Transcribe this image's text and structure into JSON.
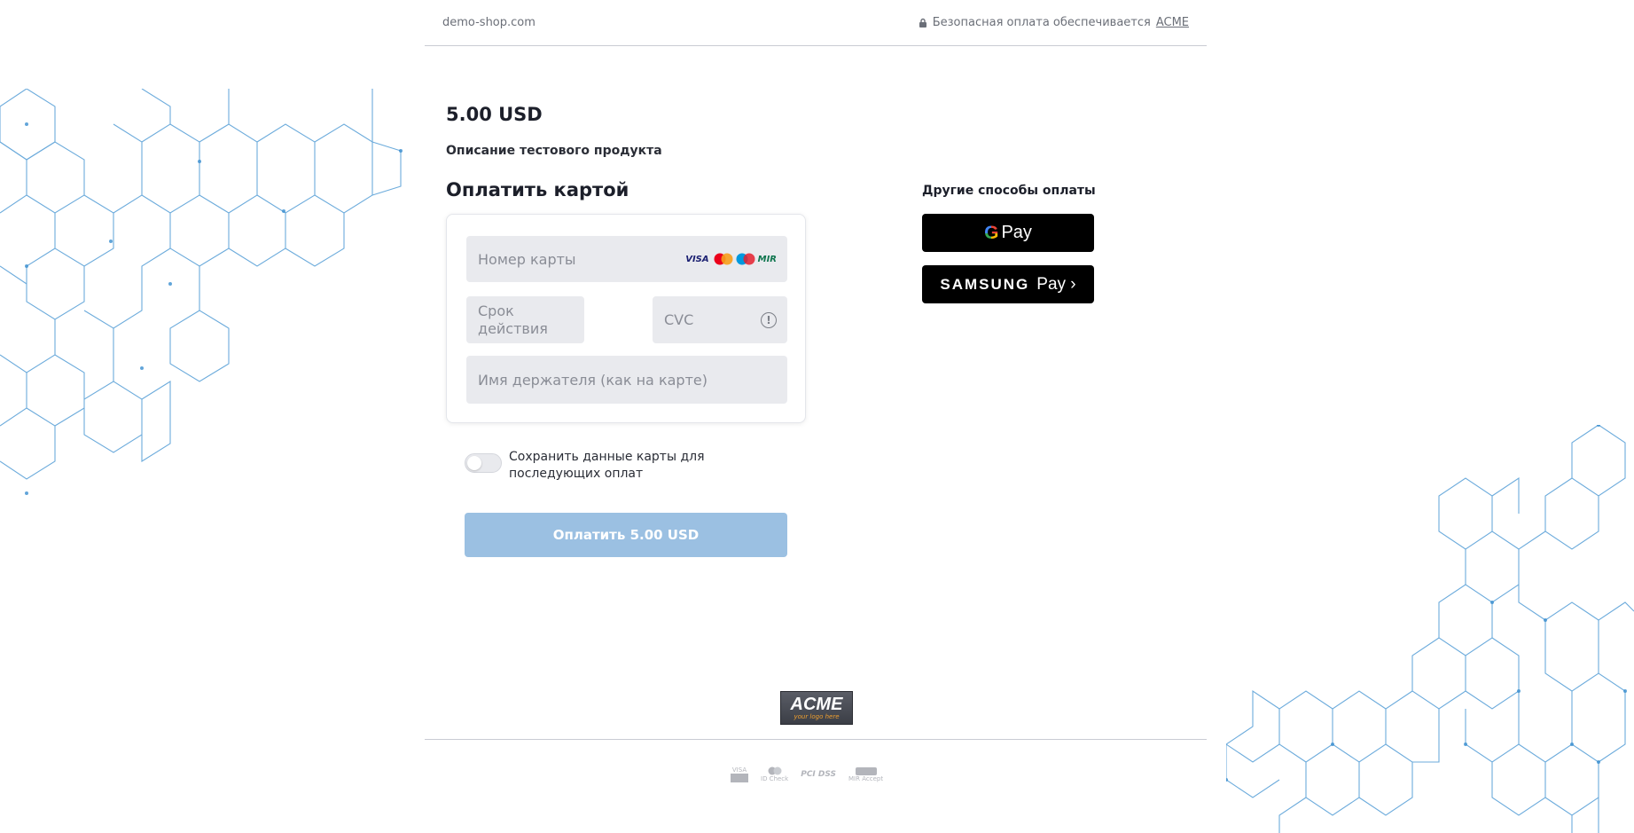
{
  "header": {
    "domain": "demo-shop.com",
    "secure_text": "Безопасная оплата обеспечивается",
    "secure_link": "ACME"
  },
  "order": {
    "amount": "5.00 USD",
    "description": "Описание тестового продукта"
  },
  "card_form": {
    "title": "Оплатить картой",
    "card_number_placeholder": "Номер карты",
    "expiry_placeholder": "Срок действия",
    "cvc_placeholder": "CVC",
    "holder_placeholder": "Имя держателя (как на карте)",
    "card_brands": [
      "VISA",
      "Mastercard",
      "Maestro",
      "MIR"
    ],
    "save_card_label": "Сохранить данные карты для последующих оплат",
    "save_card_enabled": false,
    "pay_button": "Оплатить 5.00 USD"
  },
  "other_methods": {
    "title": "Другие способы оплаты",
    "google_pay": "Pay",
    "samsung_word": "SAMSUNG",
    "samsung_pay": "Pay ›"
  },
  "footer": {
    "logo_main": "ACME",
    "logo_sub": "your logo here",
    "security_logos": [
      "VISA",
      "ID Check",
      "PCI DSS",
      "MIR Accept"
    ]
  },
  "colors": {
    "pay_button_bg": "#9bc0e2",
    "pattern_stroke": "#3b8fd0",
    "field_bg": "#e9eaee"
  }
}
